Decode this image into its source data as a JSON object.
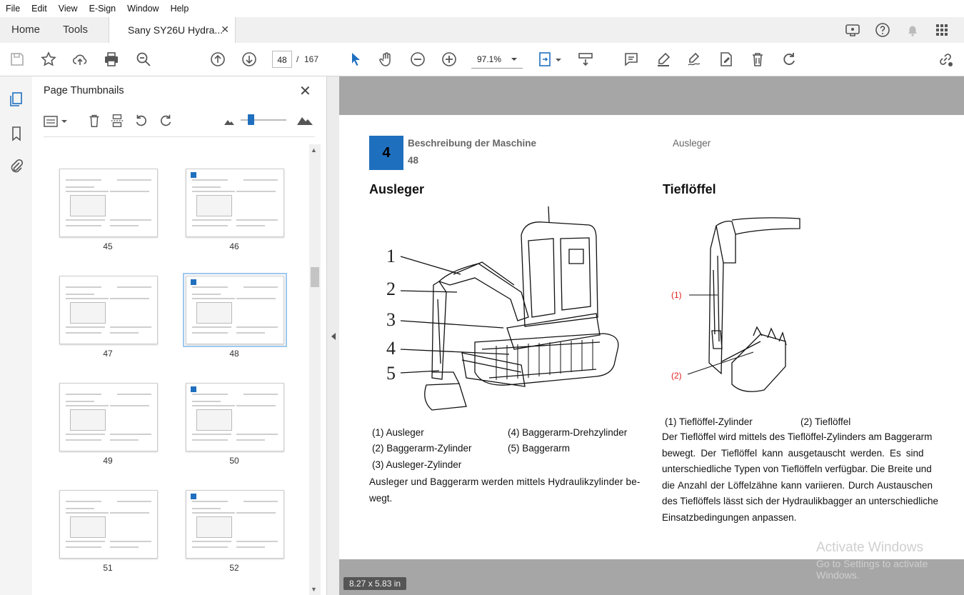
{
  "menu": [
    "File",
    "Edit",
    "View",
    "E-Sign",
    "Window",
    "Help"
  ],
  "nav": {
    "home": "Home",
    "tools": "Tools"
  },
  "doc_tab": {
    "title": "Sany SY26U Hydra...",
    "close": "✕"
  },
  "toolbar": {
    "page_current": "48",
    "page_sep": "/",
    "page_total": "167",
    "zoom": "97.1%"
  },
  "thumbnails": {
    "title": "Page Thumbnails",
    "pages": [
      "45",
      "46",
      "47",
      "48",
      "49",
      "50",
      "51",
      "52"
    ],
    "selected": "48"
  },
  "page": {
    "chapter_number": "4",
    "chapter_title": "Beschreibung der Maschine",
    "page_number": "48",
    "section_right": "Ausleger",
    "left_heading": "Ausleger",
    "right_heading": "Tieflöffel",
    "figure_left_labels": [
      "1",
      "2",
      "3",
      "4",
      "5"
    ],
    "figure_right_labels": [
      "(1)",
      "(2)"
    ],
    "left_caption": {
      "c1": "(1) Ausleger",
      "c2": "(2) Baggerarm-Zylinder",
      "c3": "(3) Ausleger-Zylinder",
      "c4": "(4) Baggerarm-Drehzylinder",
      "c5": "(5) Baggerarm"
    },
    "left_para_1": "Ausleger und Baggerarm werden mittels Hydraulikzylinder be-",
    "left_para_2": "wegt.",
    "right_caption": {
      "c1": "(1) Tieflöffel-Zylinder",
      "c2": "(2) Tieflöffel"
    },
    "right_para": [
      "Der Tieflöffel wird mittels des Tieflöffel-Zylinders am Baggerarm",
      "bewegt. Der Tieflöffel kann ausgetauscht werden. Es sind",
      "unterschiedliche Typen von Tieflöffeln verfügbar. Die Breite und",
      "die Anzahl der Löffelzähne kann variieren. Durch Austauschen",
      "des Tieflöffels lässt sich der Hydraulikbagger an unterschiedliche",
      "Einsatzbedingungen anpassen."
    ]
  },
  "status": {
    "page_size": "8.27 x 5.83 in"
  },
  "watermark": {
    "line1": "Activate Windows",
    "line2": "Go to Settings to activate Windows."
  },
  "colors": {
    "accent": "#1f6fbf",
    "doc_bg": "#a6a6a6",
    "label_red": "#e02020"
  }
}
